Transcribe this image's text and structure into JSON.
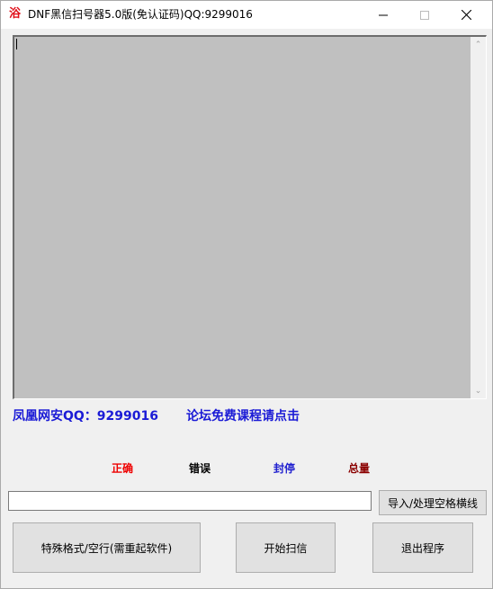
{
  "window": {
    "icon_glyph": "浴",
    "title": "DNF黑信扫号器5.0版(免认证码)QQ:9299016"
  },
  "window_controls": {
    "minimize_icon": "minimize-icon",
    "maximize_icon": "maximize-icon",
    "close_icon": "close-icon"
  },
  "log": {
    "text": ""
  },
  "links": {
    "qq_label": "凤凰网安QQ：9299016",
    "forum_label": "论坛免费课程请点击"
  },
  "stats": {
    "correct": "正确",
    "error": "错误",
    "banned": "封停",
    "total": "总量"
  },
  "colors": {
    "correct": "#ee0000",
    "error": "#000000",
    "banned": "#1f1fcf",
    "total": "#8b0000",
    "link": "#1b1bd6"
  },
  "input": {
    "value": "",
    "placeholder": ""
  },
  "buttons": {
    "import": "导入/处理空格横线",
    "special": "特殊格式/空行(需重起软件)",
    "start": "开始扫信",
    "exit": "退出程序"
  }
}
